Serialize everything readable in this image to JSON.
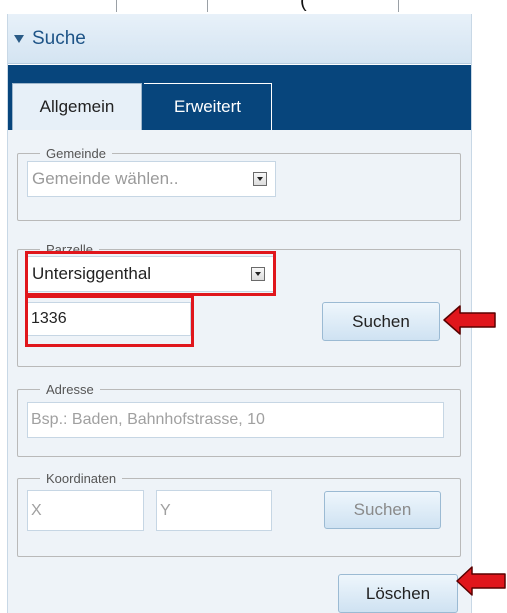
{
  "panel": {
    "title": "Suche"
  },
  "tabs": [
    {
      "label": "Allgemein",
      "active": true
    },
    {
      "label": "Erweitert",
      "active": false
    }
  ],
  "gemeinde": {
    "legend": "Gemeinde",
    "placeholder": "Gemeinde wählen.."
  },
  "parzelle": {
    "legend": "Parzelle",
    "selected": "Untersiggenthal",
    "number": "1336",
    "search_label": "Suchen"
  },
  "adresse": {
    "legend": "Adresse",
    "placeholder": "Bsp.: Baden, Bahnhofstrasse, 10"
  },
  "koordinaten": {
    "legend": "Koordinaten",
    "x_placeholder": "X",
    "y_placeholder": "Y",
    "search_label": "Suchen"
  },
  "footer": {
    "clear_label": "Löschen"
  },
  "background": {
    "fragment": "("
  },
  "colors": {
    "tabbar": "#07457c",
    "highlight": "#e0161c",
    "header_text": "#1e5487"
  }
}
